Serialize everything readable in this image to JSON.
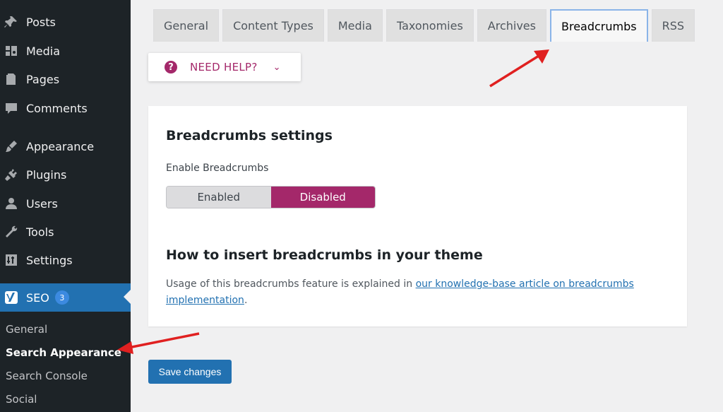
{
  "sidebar": {
    "items": [
      {
        "label": "Posts",
        "icon": "pushpin-icon"
      },
      {
        "label": "Media",
        "icon": "media-icon"
      },
      {
        "label": "Pages",
        "icon": "pages-icon"
      },
      {
        "label": "Comments",
        "icon": "comments-icon"
      },
      {
        "label": "Appearance",
        "icon": "paintbrush-icon"
      },
      {
        "label": "Plugins",
        "icon": "plugin-icon"
      },
      {
        "label": "Users",
        "icon": "user-icon"
      },
      {
        "label": "Tools",
        "icon": "wrench-icon"
      },
      {
        "label": "Settings",
        "icon": "settings-icon"
      }
    ],
    "seo": {
      "label": "SEO",
      "badge": "3",
      "icon": "yoast-icon"
    },
    "submenu": [
      "General",
      "Search Appearance",
      "Search Console",
      "Social"
    ]
  },
  "tabs": [
    "General",
    "Content Types",
    "Media",
    "Taxonomies",
    "Archives",
    "Breadcrumbs",
    "RSS"
  ],
  "active_tab": "Breadcrumbs",
  "help": {
    "label": "NEED HELP?",
    "icon": "question-icon"
  },
  "card": {
    "title": "Breadcrumbs settings",
    "enable_label": "Enable Breadcrumbs",
    "toggle": {
      "enabled": "Enabled",
      "disabled": "Disabled",
      "selected": "Disabled"
    },
    "howto_title": "How to insert breadcrumbs in your theme",
    "desc_prefix": "Usage of this breadcrumbs feature is explained in ",
    "desc_link": "our knowledge-base article on breadcrumbs implementation",
    "desc_suffix": "."
  },
  "save_label": "Save changes",
  "colors": {
    "sidebar": "#1d2327",
    "accent": "#2271b1",
    "yoast": "#a4286a",
    "annotation": "#e02020"
  }
}
